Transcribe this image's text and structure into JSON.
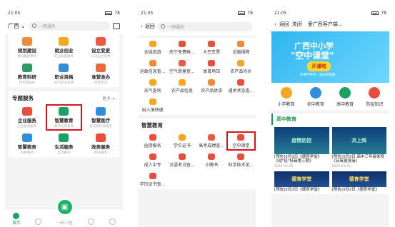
{
  "phone1": {
    "status": {
      "time": "21:05",
      "batt": "78"
    },
    "city": "广西",
    "search_placeholder": "一网通办",
    "top_grid": [
      {
        "label": "规划建设",
        "sub": "建设报批事项",
        "color": "#f08a3a"
      },
      {
        "label": "就业创业",
        "sub": "职业技能教育",
        "color": "#f5a623"
      },
      {
        "label": "设立变更",
        "sub": "公司设立变更",
        "color": "#e85a46"
      },
      {
        "label": "教育科研",
        "sub": "转考等服务",
        "color": "#2c9b6a"
      },
      {
        "label": "职业资格",
        "sub": "执行职业资格",
        "color": "#2f8fdd"
      },
      {
        "label": "准营准办",
        "sub": "经营许可",
        "color": "#eb6b3a"
      }
    ],
    "section_title": "专题服务",
    "section_more": "更多 >",
    "special_grid": [
      {
        "label": "企业服务",
        "sub": "企业相关服务",
        "color": "#e84d3d"
      },
      {
        "label": "智慧教育",
        "sub": "教育信息查询",
        "color": "#1aa260",
        "highlight": true
      },
      {
        "label": "智慧医疗",
        "sub": "挂号预约等服务",
        "color": "#2f8fdd"
      },
      {
        "label": "智慧税务",
        "sub": "办税事项",
        "color": "#2f8fdd"
      },
      {
        "label": "生活服务",
        "sub": "生活服务",
        "color": "#1aa260"
      },
      {
        "label": "政务服务",
        "sub": "政务服务",
        "color": "#e84d3d"
      }
    ],
    "tabs": [
      {
        "label": "首页",
        "active": true
      },
      {
        "label": "",
        "active": false
      },
      {
        "label": "一码八桂",
        "active": false
      },
      {
        "label": "",
        "active": false
      },
      {
        "label": "",
        "active": false
      }
    ]
  },
  "phone2": {
    "status": {
      "time": "21:05",
      "batt": "78"
    },
    "back": "返回",
    "search_placeholder": "一网通办",
    "grid": [
      {
        "label": "全城旅游",
        "color": "#f5a623"
      },
      {
        "label": "南宁免费鲜...",
        "color": "#e84d3d"
      },
      {
        "label": "大巴车票",
        "color": "#e84d3d"
      },
      {
        "label": "设施报障",
        "color": "#f08a3a"
      },
      {
        "label": "运政信息查...",
        "color": "#f08a3a"
      },
      {
        "label": "空气质量查...",
        "color": "#e85a46"
      },
      {
        "label": "体育场馆",
        "color": "#e84d3d"
      },
      {
        "label": "农产品均价",
        "color": "#f5a623"
      },
      {
        "label": "天气查询",
        "color": "#f5a623"
      },
      {
        "label": "农产品信息",
        "color": "#f5a623"
      },
      {
        "label": "农产品供求",
        "color": "#f08a3a"
      },
      {
        "label": "通关状态查...",
        "color": "#e84d3d"
      },
      {
        "label": "出入境快递",
        "color": "#f5a623"
      }
    ],
    "section_title": "智慧教育",
    "edu_grid": [
      {
        "label": "函授报名",
        "color": "#e84d3d"
      },
      {
        "label": "学位证书",
        "color": "#f5a623"
      },
      {
        "label": "高考成绩查...",
        "color": "#e85a46"
      },
      {
        "label": "空中课堂",
        "color": "#e84d3d",
        "highlight": true
      },
      {
        "label": "成人中专",
        "color": "#e84d3d"
      },
      {
        "label": "汉语考试查...",
        "color": "#e84d3d"
      },
      {
        "label": "小腾书",
        "color": "#e84d3d"
      },
      {
        "label": "科学技术奖...",
        "color": "#e84d3d"
      },
      {
        "label": "学历证书查...",
        "color": "#e84d3d"
      }
    ]
  },
  "phone3": {
    "status": {
      "time": "21:05",
      "batt": "78"
    },
    "back": "返回",
    "close": "关闭",
    "title": "爱广西客户端...",
    "banner": {
      "line1": "广西中小学",
      "line2": "\"空中课堂\"",
      "cta": "开课啦",
      "foot": "停课不停学，再战不跑题"
    },
    "cats": [
      {
        "label": "小学教育",
        "color": "#f5a623"
      },
      {
        "label": "初中教育",
        "color": "#2f8fdd"
      },
      {
        "label": "高中教育",
        "color": "#1aa260"
      },
      {
        "label": "防疫知识",
        "color": "#e84d3d"
      }
    ],
    "tag": "高中教育",
    "videos": [
      {
        "thumb": "疫情防控",
        "title": "[预告]3月3日《德育学堂》《战\"疫\"特辑第三期》",
        "date": "2020-03-03"
      },
      {
        "thumb": "共上阵",
        "title": "[预告]3月3日 高中三年级体育《有氧健身操》",
        "date": "2020-03-03"
      },
      {
        "thumb": "德育学堂",
        "title": "[预告]3月3日《德育学堂》",
        "date": ""
      },
      {
        "thumb": "德育学堂",
        "title": "[预告]3月3日《德育学堂》",
        "date": ""
      }
    ]
  }
}
